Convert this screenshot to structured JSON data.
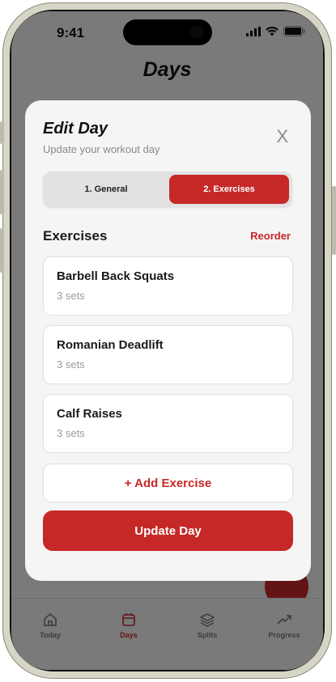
{
  "status_bar": {
    "time": "9:41"
  },
  "page": {
    "title": "Days"
  },
  "modal": {
    "title": "Edit Day",
    "subtitle": "Update your workout day",
    "close_label": "X",
    "steps": [
      {
        "label": "1. General",
        "active": false
      },
      {
        "label": "2. Exercises",
        "active": true
      }
    ],
    "section_title": "Exercises",
    "reorder_label": "Reorder",
    "exercises": [
      {
        "name": "Barbell Back Squats",
        "sets": "3 sets"
      },
      {
        "name": "Romanian Deadlift",
        "sets": "3 sets"
      },
      {
        "name": "Calf Raises",
        "sets": "3 sets"
      }
    ],
    "add_label": "+ Add Exercise",
    "submit_label": "Update Day"
  },
  "tabbar": {
    "items": [
      {
        "label": "Today",
        "icon": "home-icon",
        "active": false
      },
      {
        "label": "Days",
        "icon": "calendar-icon",
        "active": true
      },
      {
        "label": "Splits",
        "icon": "layers-icon",
        "active": false
      },
      {
        "label": "Progress",
        "icon": "trending-up-icon",
        "active": false
      }
    ]
  },
  "colors": {
    "accent": "#c62828",
    "background": "#f5f5f5",
    "muted_text": "#8a8a8a"
  }
}
